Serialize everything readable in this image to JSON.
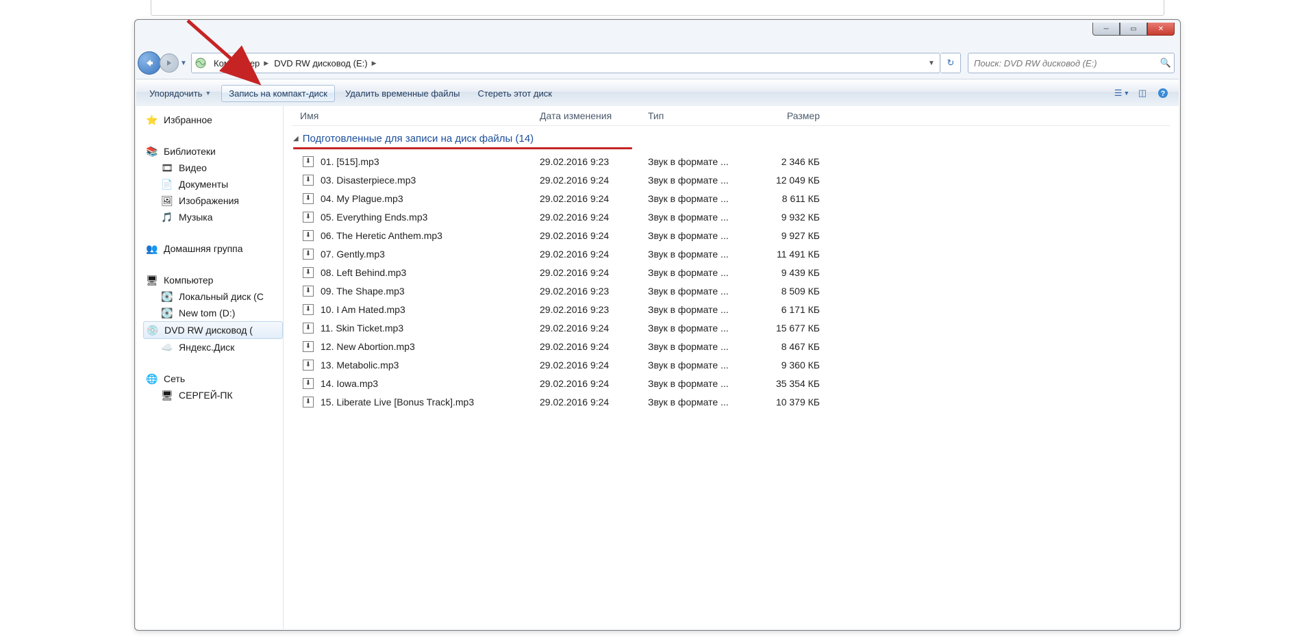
{
  "breadcrumbs": {
    "root": "Компьютер",
    "current": "DVD RW дисковод (E:)"
  },
  "search_placeholder": "Поиск: DVD RW дисковод (E:)",
  "toolbar": {
    "organize": "Упорядочить",
    "burn": "Запись на компакт-диск",
    "delete_temp": "Удалить временные файлы",
    "erase": "Стереть этот диск"
  },
  "sidebar": {
    "favorites": "Избранное",
    "libraries": "Библиотеки",
    "video": "Видео",
    "documents": "Документы",
    "pictures": "Изображения",
    "music": "Музыка",
    "homegroup": "Домашняя группа",
    "computer": "Компьютер",
    "local_c": "Локальный диск (C",
    "new_tom": "New tom (D:)",
    "dvd": "DVD RW дисковод (",
    "yandex": "Яндекс.Диск",
    "network": "Сеть",
    "sergey_pc": "СЕРГЕЙ-ПК"
  },
  "columns": {
    "name": "Имя",
    "date": "Дата изменения",
    "type": "Тип",
    "size": "Размер"
  },
  "group_header": "Подготовленные для записи на диск файлы (14)",
  "type_label": "Звук в формате ...",
  "files": [
    {
      "name": "01. [515].mp3",
      "date": "29.02.2016 9:23",
      "size": "2 346 КБ"
    },
    {
      "name": "03. Disasterpiece.mp3",
      "date": "29.02.2016 9:24",
      "size": "12 049 КБ"
    },
    {
      "name": "04. My Plague.mp3",
      "date": "29.02.2016 9:24",
      "size": "8 611 КБ"
    },
    {
      "name": "05. Everything Ends.mp3",
      "date": "29.02.2016 9:24",
      "size": "9 932 КБ"
    },
    {
      "name": "06. The Heretic Anthem.mp3",
      "date": "29.02.2016 9:24",
      "size": "9 927 КБ"
    },
    {
      "name": "07. Gently.mp3",
      "date": "29.02.2016 9:24",
      "size": "11 491 КБ"
    },
    {
      "name": "08. Left Behind.mp3",
      "date": "29.02.2016 9:24",
      "size": "9 439 КБ"
    },
    {
      "name": "09. The Shape.mp3",
      "date": "29.02.2016 9:23",
      "size": "8 509 КБ"
    },
    {
      "name": "10. I Am Hated.mp3",
      "date": "29.02.2016 9:23",
      "size": "6 171 КБ"
    },
    {
      "name": "11. Skin Ticket.mp3",
      "date": "29.02.2016 9:24",
      "size": "15 677 КБ"
    },
    {
      "name": "12. New Abortion.mp3",
      "date": "29.02.2016 9:24",
      "size": "8 467 КБ"
    },
    {
      "name": "13. Metabolic.mp3",
      "date": "29.02.2016 9:24",
      "size": "9 360 КБ"
    },
    {
      "name": "14. Iowa.mp3",
      "date": "29.02.2016 9:24",
      "size": "35 354 КБ"
    },
    {
      "name": "15. Liberate Live [Bonus Track].mp3",
      "date": "29.02.2016 9:24",
      "size": "10 379 КБ"
    }
  ]
}
